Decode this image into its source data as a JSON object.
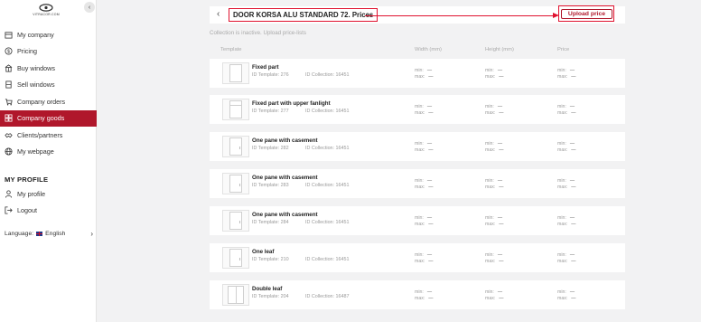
{
  "app": {
    "logo_text": "VITRACOR.COM"
  },
  "sidebar": {
    "items": [
      {
        "label": "My company",
        "icon": "company-icon"
      },
      {
        "label": "Pricing",
        "icon": "dollar-icon"
      },
      {
        "label": "Buy windows",
        "icon": "buy-window-icon"
      },
      {
        "label": "Sell windows",
        "icon": "sell-window-icon"
      },
      {
        "label": "Company orders",
        "icon": "orders-icon"
      },
      {
        "label": "Company goods",
        "icon": "goods-icon",
        "active": true
      },
      {
        "label": "Clients/partners",
        "icon": "partners-icon"
      },
      {
        "label": "My webpage",
        "icon": "globe-icon"
      }
    ],
    "profile_title": "MY PROFILE",
    "profile_items": [
      {
        "label": "My profile",
        "icon": "user-icon"
      },
      {
        "label": "Logout",
        "icon": "logout-icon"
      }
    ],
    "language_label": "Language:",
    "language_value": "English"
  },
  "page": {
    "title": "DOOR KORSA ALU STANDARD 72. Prices",
    "upload_label": "Upload price",
    "notice": "Collection is inactive. Upload price-lists",
    "columns": {
      "template": "Template",
      "width": "Width (mm)",
      "height": "Height (mm)",
      "price": "Price"
    }
  },
  "rows": [
    {
      "name": "Fixed part",
      "id": "ID Template: 276",
      "collection": "ID Collection: 16451",
      "shape": "plain"
    },
    {
      "name": "Fixed part with upper fanlight",
      "id": "ID Template: 277",
      "collection": "ID Collection: 16451",
      "shape": "fanlight"
    },
    {
      "name": "One pane with casement",
      "id": "ID Template: 282",
      "collection": "ID Collection: 16451",
      "shape": "casement"
    },
    {
      "name": "One pane with casement",
      "id": "ID Template: 283",
      "collection": "ID Collection: 16451",
      "shape": "casement"
    },
    {
      "name": "One pane with casement",
      "id": "ID Template: 284",
      "collection": "ID Collection: 16451",
      "shape": "casement"
    },
    {
      "name": "One leaf",
      "id": "ID Template: 210",
      "collection": "ID Collection: 16451",
      "shape": "casement"
    },
    {
      "name": "Double leaf",
      "id": "ID Template: 204",
      "collection": "ID Collection: 16487",
      "shape": "double"
    }
  ],
  "minmax": {
    "min_label": "min:",
    "max_label": "max:",
    "empty": "—"
  },
  "colors": {
    "accent": "#b0172b",
    "annotation": "#e0122f"
  }
}
